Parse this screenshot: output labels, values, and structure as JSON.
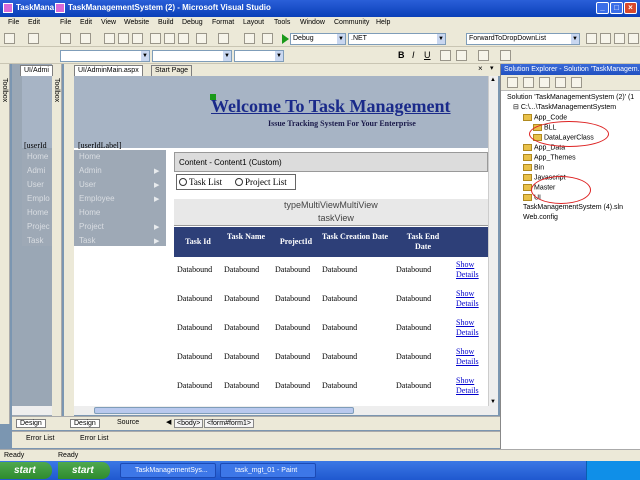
{
  "window": {
    "title_front": "TaskManagementSystem (2) - Microsoft Visual Studio",
    "title_back": "TaskMana"
  },
  "menu": {
    "back_items": [
      "File",
      "Edit"
    ],
    "items": [
      "File",
      "Edit",
      "View",
      "Website",
      "Build",
      "Debug",
      "Format",
      "Layout",
      "Tools",
      "Window",
      "Community",
      "Help"
    ]
  },
  "toolbar": {
    "config": "Debug",
    "platform": ".NET",
    "find": "ForwardToDropDownList"
  },
  "toolbox": {
    "label": "Toolbox"
  },
  "tabs": {
    "back_doc": "UI/Admi",
    "main_doc": "UI/AdminMain.aspx",
    "start": "Start Page"
  },
  "page": {
    "welcome": "Welcome To Task Management",
    "subtitle": "Issue Tracking System For Your Enterprise",
    "user_label_back": "[userId",
    "user_label": "[userIdLabel]",
    "nav_back": [
      "Home",
      "Admi",
      "User",
      "Emplo",
      "Home",
      "Projec",
      "Task"
    ],
    "nav": [
      "Home",
      "Admin",
      "User",
      "Employee",
      "Home",
      "Project",
      "Task"
    ],
    "content_label": "Content - Content1 (Custom)",
    "radio1": "Task List",
    "radio2": "Project List",
    "multiview": "typeMultiViewMultiView",
    "view": "taskView",
    "grid_headers": [
      "Task Id",
      "Task Name",
      "ProjectId",
      "Task Creation Date",
      "Task End Date"
    ],
    "databound": "Databound",
    "link1": "Show",
    "link2": "Details"
  },
  "bottom": {
    "design": "Design",
    "source": "Source",
    "body_tag": "<body>",
    "form_tag": "<form#form1>",
    "error_list": "Error List"
  },
  "solution_explorer": {
    "title": "Solution Explorer - Solution 'TaskManagem...",
    "items": [
      "Solution 'TaskManagementSystem (2)' (1",
      "C:\\...\\TaskManagementSystem",
      "App_Code",
      "BLL",
      "DataLayerClass",
      "App_Data",
      "App_Themes",
      "Bin",
      "Javascript",
      "Master",
      "UI",
      "TaskManagementSystem (4).sln",
      "Web.config"
    ]
  },
  "status": {
    "text": "Ready"
  },
  "taskbar": {
    "start": "start",
    "tasks": [
      "TaskManagementSys...",
      "task_mgt_01 - Paint"
    ]
  },
  "colors": {
    "grid_header": "#2d3f78",
    "banner": "#a7b4c5",
    "nav_bg": "#9ea9b6",
    "highlight_circle": "#dd2222"
  }
}
